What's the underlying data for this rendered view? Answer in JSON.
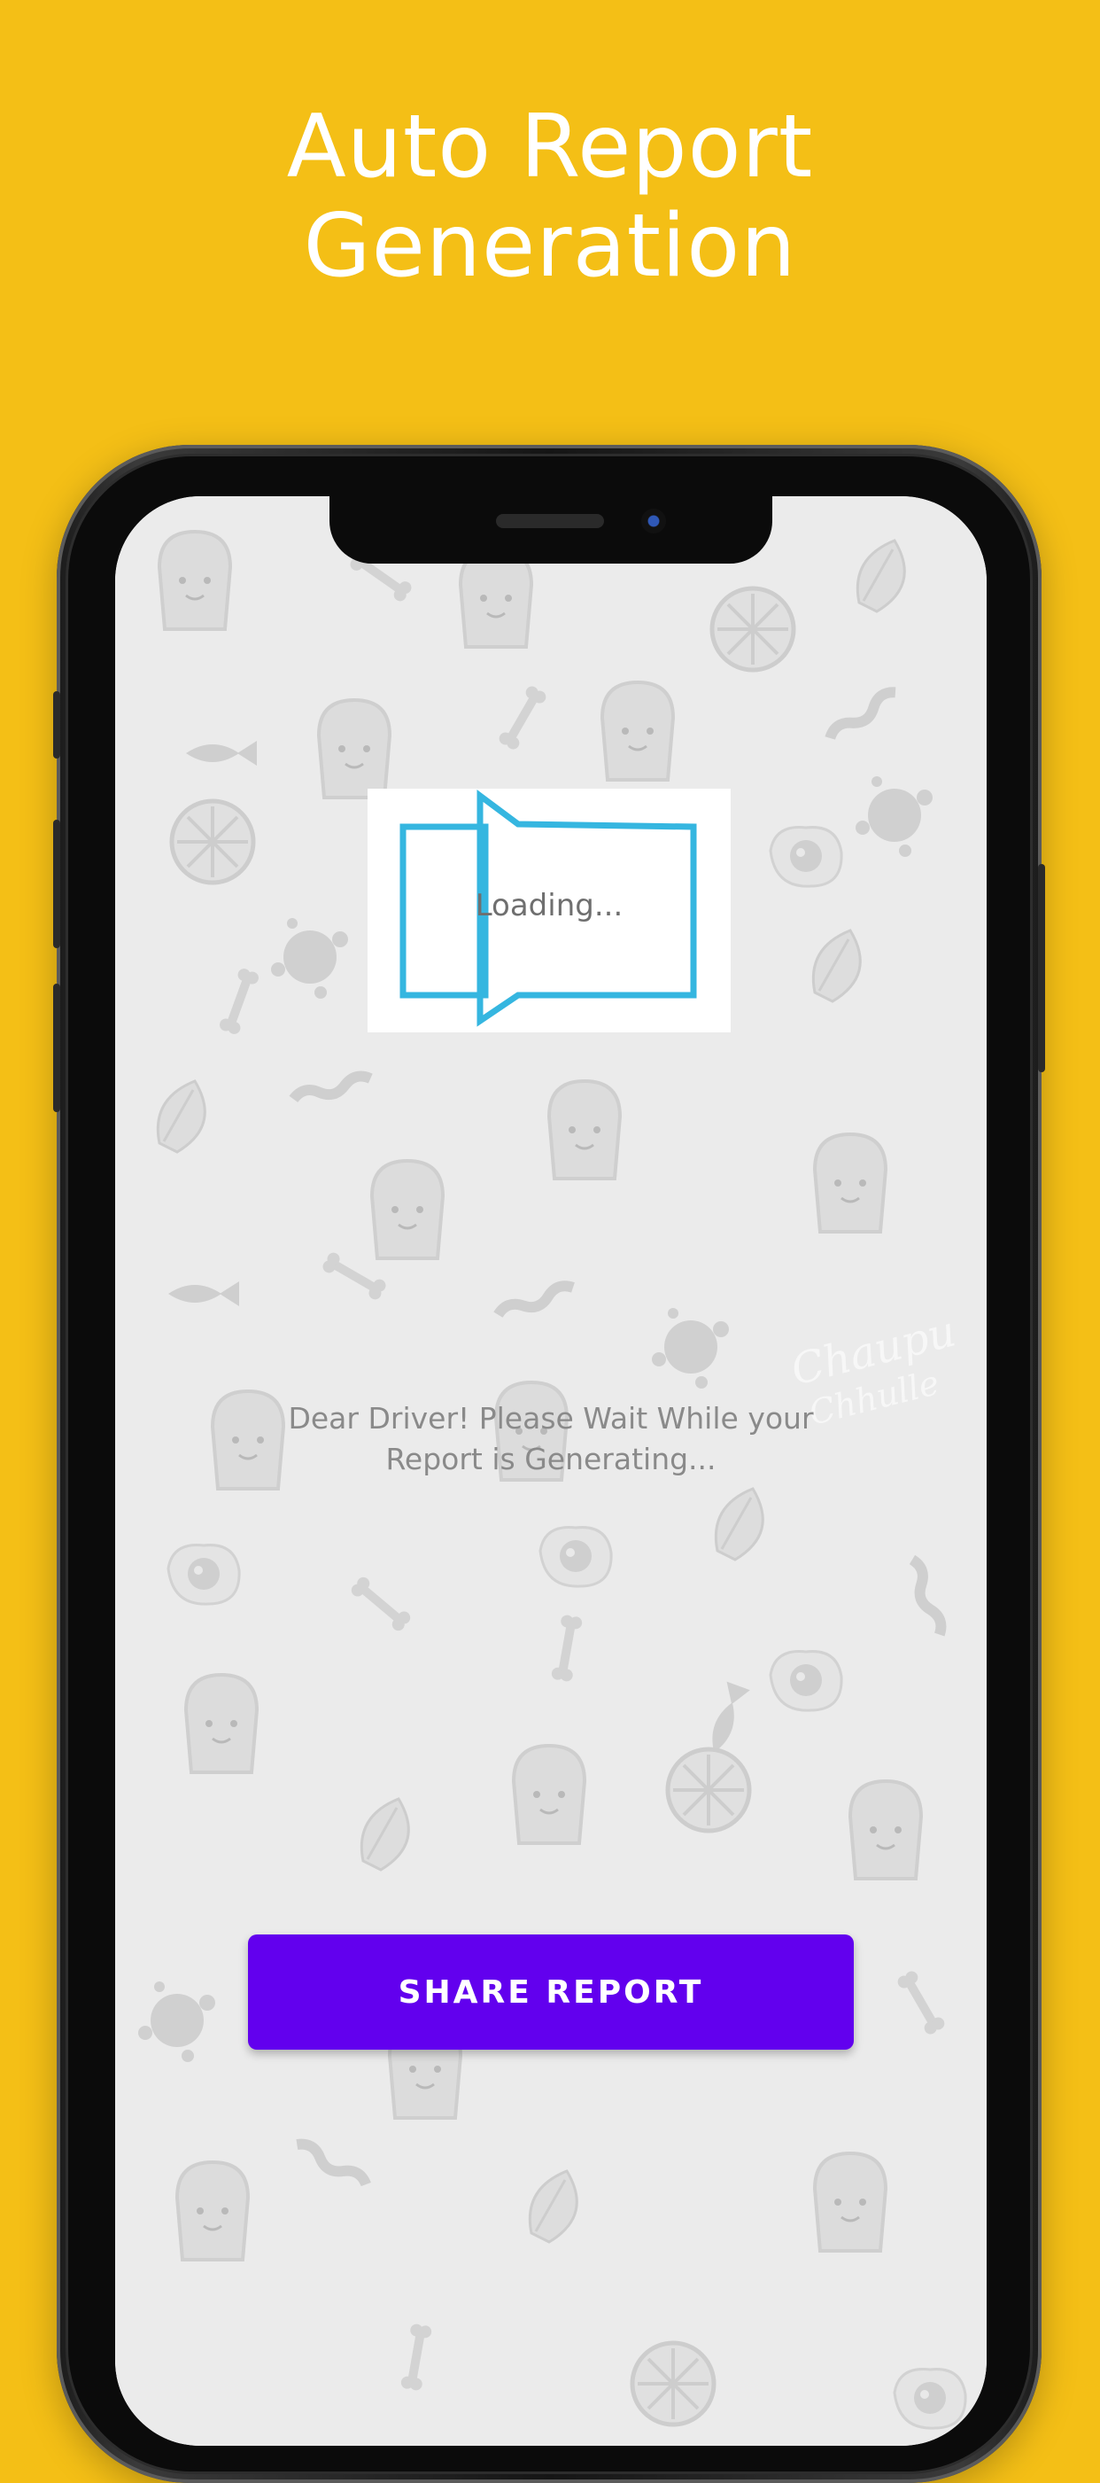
{
  "headline": {
    "line1": "Auto Report",
    "line2": "Generation"
  },
  "screen": {
    "loading_text": "Loading...",
    "status_message": "Dear Driver! Please Wait While your Report is Generating...",
    "share_button_label": "SHARE REPORT",
    "background_watermark": "Chaupu Chhulle"
  },
  "colors": {
    "page_background": "#F4BF16",
    "headline_text": "#FFFFFF",
    "button": "#6200EE",
    "loader_outline": "#35B6E0"
  },
  "icons": {
    "background_pattern": "food-doodle-pattern",
    "loader": "folder-outline-icon"
  }
}
